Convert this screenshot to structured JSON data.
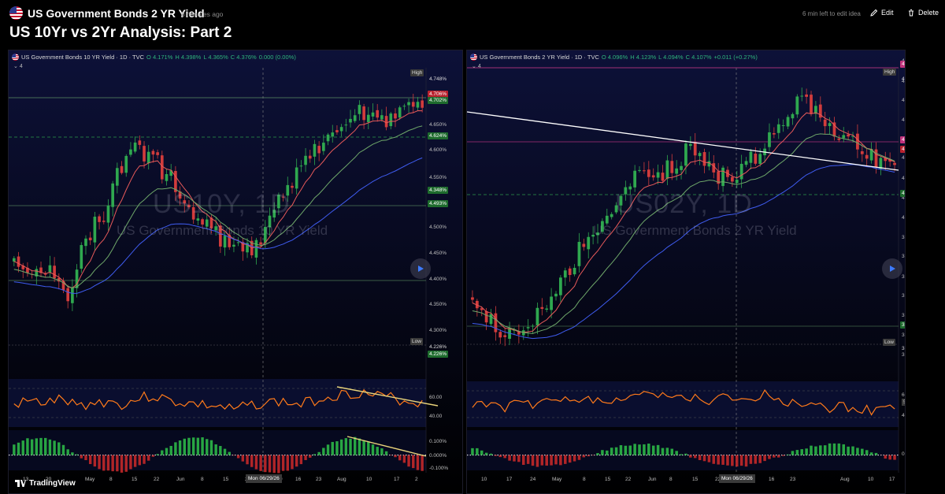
{
  "header": {
    "symbol_title": "US Government Bonds 2 YR Yield",
    "time_ago": "8 minutes ago",
    "edit_time_left": "6 min left to edit idea",
    "edit_label": "Edit",
    "delete_label": "Delete",
    "idea_title": "US 10Yr vs 2Yr Analysis: Part 2"
  },
  "colors": {
    "up": "#2fa84f",
    "down": "#d23c3c",
    "ema_fast": "#e85a5a",
    "ema_mid": "#6fa86a",
    "ema_slow": "#3f5cf0",
    "rsi": "#ff7a1a",
    "trendline": "#ffffff",
    "div_line": "#e8d27a",
    "hist_up": "#2fc24a",
    "hist_down": "#d02a2a",
    "bg_top": "#0d1138",
    "bg_bottom": "#000000"
  },
  "watermark_brand": "TradingView",
  "panes": [
    {
      "id": "us10y",
      "legend": {
        "name": "US Government Bonds 10 YR Yield · 1D · TVC",
        "o": "O 4.171%",
        "h": "H 4.398%",
        "l": "L 4.365%",
        "c": "C 4.376%",
        "chg": "0.000 (0.00%)"
      },
      "indicator_count": "4",
      "watermark_symbol": "US10Y, 1D",
      "watermark_desc": "US Government Bonds 10 YR Yield",
      "price_ticks": [
        "4.650%",
        "4.600%",
        "4.550%",
        "4.500%",
        "4.450%",
        "4.400%",
        "4.350%",
        "4.300%",
        "4.250%",
        "4.200%"
      ],
      "price_labels": [
        {
          "text": "High",
          "kind": "tag"
        },
        {
          "text": "4.748%",
          "kind": "plain"
        },
        {
          "text": "4.706%",
          "kind": "red"
        },
        {
          "text": "4.702%",
          "kind": "green"
        },
        {
          "text": "4.624%",
          "kind": "green"
        },
        {
          "text": "4.493%",
          "kind": "green"
        },
        {
          "text": "4.348%",
          "kind": "green"
        },
        {
          "text": "Low",
          "kind": "tag"
        },
        {
          "text": "4.226%",
          "kind": "plain"
        },
        {
          "text": "4.226%",
          "kind": "green"
        }
      ],
      "rsi_ticks": [
        "60.00",
        "40.00"
      ],
      "macd_ticks": [
        "0.100%",
        "0.000%",
        "-0.100%"
      ],
      "date_ticks": [
        "13",
        "20",
        "May",
        "8",
        "15",
        "22",
        "Jun",
        "8",
        "15",
        "2",
        "9",
        "16",
        "23",
        "Aug",
        "10",
        "17",
        "2"
      ],
      "cursor_date": "Mon 06/29/26"
    },
    {
      "id": "us02y",
      "legend": {
        "name": "US Government Bonds 2 YR Yield · 1D · TVC",
        "o": "O 4.096%",
        "h": "H 4.123%",
        "l": "L 4.094%",
        "c": "C 4.107%",
        "chg": "+0.011 (+0.27%)"
      },
      "indicator_count": "4",
      "watermark_symbol": "US02Y, 1D",
      "watermark_desc": "US Government Bonds 2 YR Yield",
      "price_ticks": [
        "4.400%",
        "4.350%",
        "4.300%",
        "4.250%",
        "4.150%",
        "4.100%",
        "4.050%",
        "4.000%",
        "3.950%",
        "3.900%",
        "3.850%",
        "3.800%",
        "3.750%",
        "3.700%",
        "3.650%"
      ],
      "price_labels": [
        {
          "text": "4.382%",
          "kind": "pink"
        },
        {
          "text": "High",
          "kind": "tag"
        },
        {
          "text": "4.370%",
          "kind": "plain"
        },
        {
          "text": "4.197%",
          "kind": "pink"
        },
        {
          "text": "4.173%",
          "kind": "red"
        },
        {
          "text": "4.060%",
          "kind": "green"
        },
        {
          "text": "3.727%",
          "kind": "green"
        },
        {
          "text": "Low",
          "kind": "tag"
        },
        {
          "text": "3.679%",
          "kind": "plain"
        }
      ],
      "rsi_ticks": [
        "60.00",
        "54.59",
        "40.00"
      ],
      "macd_ticks": [
        "0.000%"
      ],
      "date_ticks": [
        "10",
        "17",
        "24",
        "May",
        "8",
        "15",
        "22",
        "Jun",
        "8",
        "15",
        "22",
        "9",
        "16",
        "23",
        "Aug",
        "10",
        "17"
      ],
      "cursor_date": "Mon 06/29/26"
    }
  ]
}
